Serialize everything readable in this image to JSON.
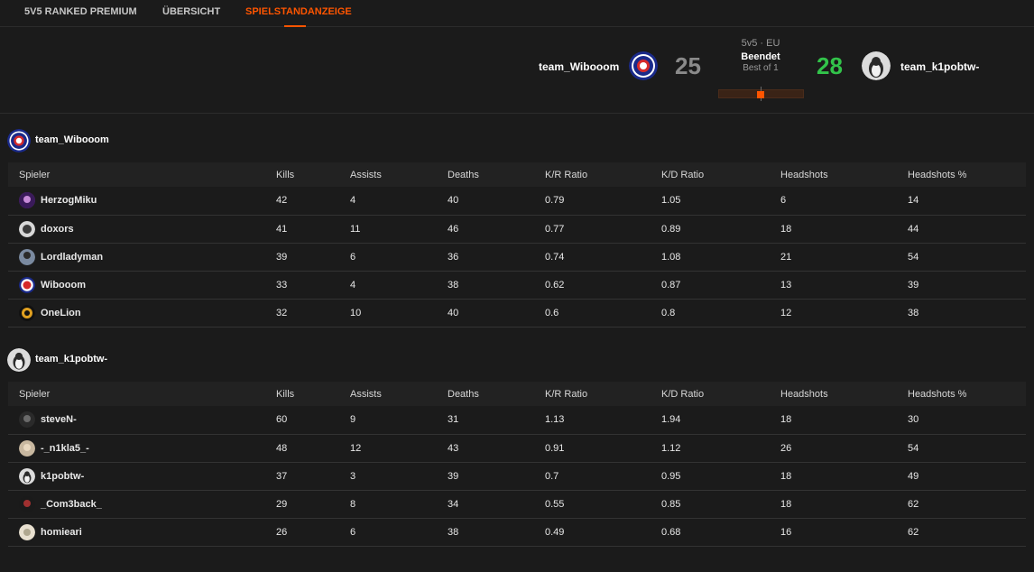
{
  "tabs": [
    {
      "label": "5V5 RANKED PREMIUM",
      "active": false
    },
    {
      "label": "ÜBERSICHT",
      "active": false
    },
    {
      "label": "SPIELSTANDANZEIGE",
      "active": true
    }
  ],
  "match": {
    "team1": {
      "name": "team_Wibooom",
      "score": "25"
    },
    "team2": {
      "name": "team_k1pobtw-",
      "score": "28"
    },
    "mode": "5v5 · EU",
    "status": "Beendet",
    "format": "Best of 1"
  },
  "columns": [
    "Spieler",
    "Kills",
    "Assists",
    "Deaths",
    "K/R Ratio",
    "K/D Ratio",
    "Headshots",
    "Headshots %"
  ],
  "teams": [
    {
      "name": "team_Wibooom",
      "players": [
        {
          "name": "HerzogMiku",
          "stats": [
            "42",
            "4",
            "40",
            "0.79",
            "1.05",
            "6",
            "14"
          ]
        },
        {
          "name": "doxors",
          "stats": [
            "41",
            "11",
            "46",
            "0.77",
            "0.89",
            "18",
            "44"
          ]
        },
        {
          "name": "Lordladyman",
          "stats": [
            "39",
            "6",
            "36",
            "0.74",
            "1.08",
            "21",
            "54"
          ]
        },
        {
          "name": "Wibooom",
          "stats": [
            "33",
            "4",
            "38",
            "0.62",
            "0.87",
            "13",
            "39"
          ]
        },
        {
          "name": "OneLion",
          "stats": [
            "32",
            "10",
            "40",
            "0.6",
            "0.8",
            "12",
            "38"
          ]
        }
      ]
    },
    {
      "name": "team_k1pobtw-",
      "players": [
        {
          "name": "steveN-",
          "stats": [
            "60",
            "9",
            "31",
            "1.13",
            "1.94",
            "18",
            "30"
          ]
        },
        {
          "name": "-_n1kla5_-",
          "stats": [
            "48",
            "12",
            "43",
            "0.91",
            "1.12",
            "26",
            "54"
          ]
        },
        {
          "name": "k1pobtw-",
          "stats": [
            "37",
            "3",
            "39",
            "0.7",
            "0.95",
            "18",
            "49"
          ]
        },
        {
          "name": "_Com3back_",
          "stats": [
            "29",
            "8",
            "34",
            "0.55",
            "0.85",
            "18",
            "62"
          ]
        },
        {
          "name": "homieari",
          "stats": [
            "26",
            "6",
            "38",
            "0.49",
            "0.68",
            "16",
            "62"
          ]
        }
      ]
    }
  ],
  "colors": {
    "accent": "#ff5500",
    "win": "#32c34a",
    "lose": "#8a8a8a",
    "background": "#1b1b1b"
  }
}
